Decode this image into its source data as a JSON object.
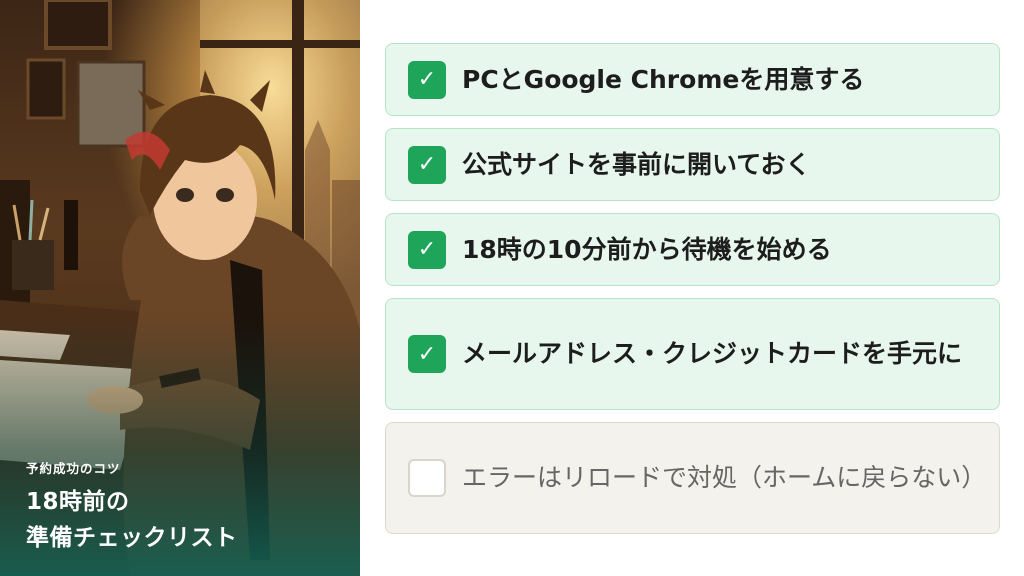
{
  "hero": {
    "kicker": "予約成功のコツ",
    "title_line1": "18時前の",
    "title_line2": "準備チェックリスト"
  },
  "checklist": {
    "items": [
      {
        "label": "PCとGoogle Chromeを用意する",
        "checked": true,
        "check_glyph": "✓"
      },
      {
        "label": "公式サイトを事前に開いておく",
        "checked": true,
        "check_glyph": "✓"
      },
      {
        "label": "18時の10分前から待機を始める",
        "checked": true,
        "check_glyph": "✓"
      },
      {
        "label": "メールアドレス・クレジットカードを手元に",
        "checked": true,
        "check_glyph": "✓"
      },
      {
        "label": "エラーはリロードで対処（ホームに戻らない）",
        "checked": false,
        "check_glyph": ""
      }
    ],
    "colors": {
      "done_bg": "#e8f7ee",
      "done_border": "#b7e3c8",
      "check_green": "#1ea55a",
      "pending_bg": "#f4f2ec"
    }
  }
}
